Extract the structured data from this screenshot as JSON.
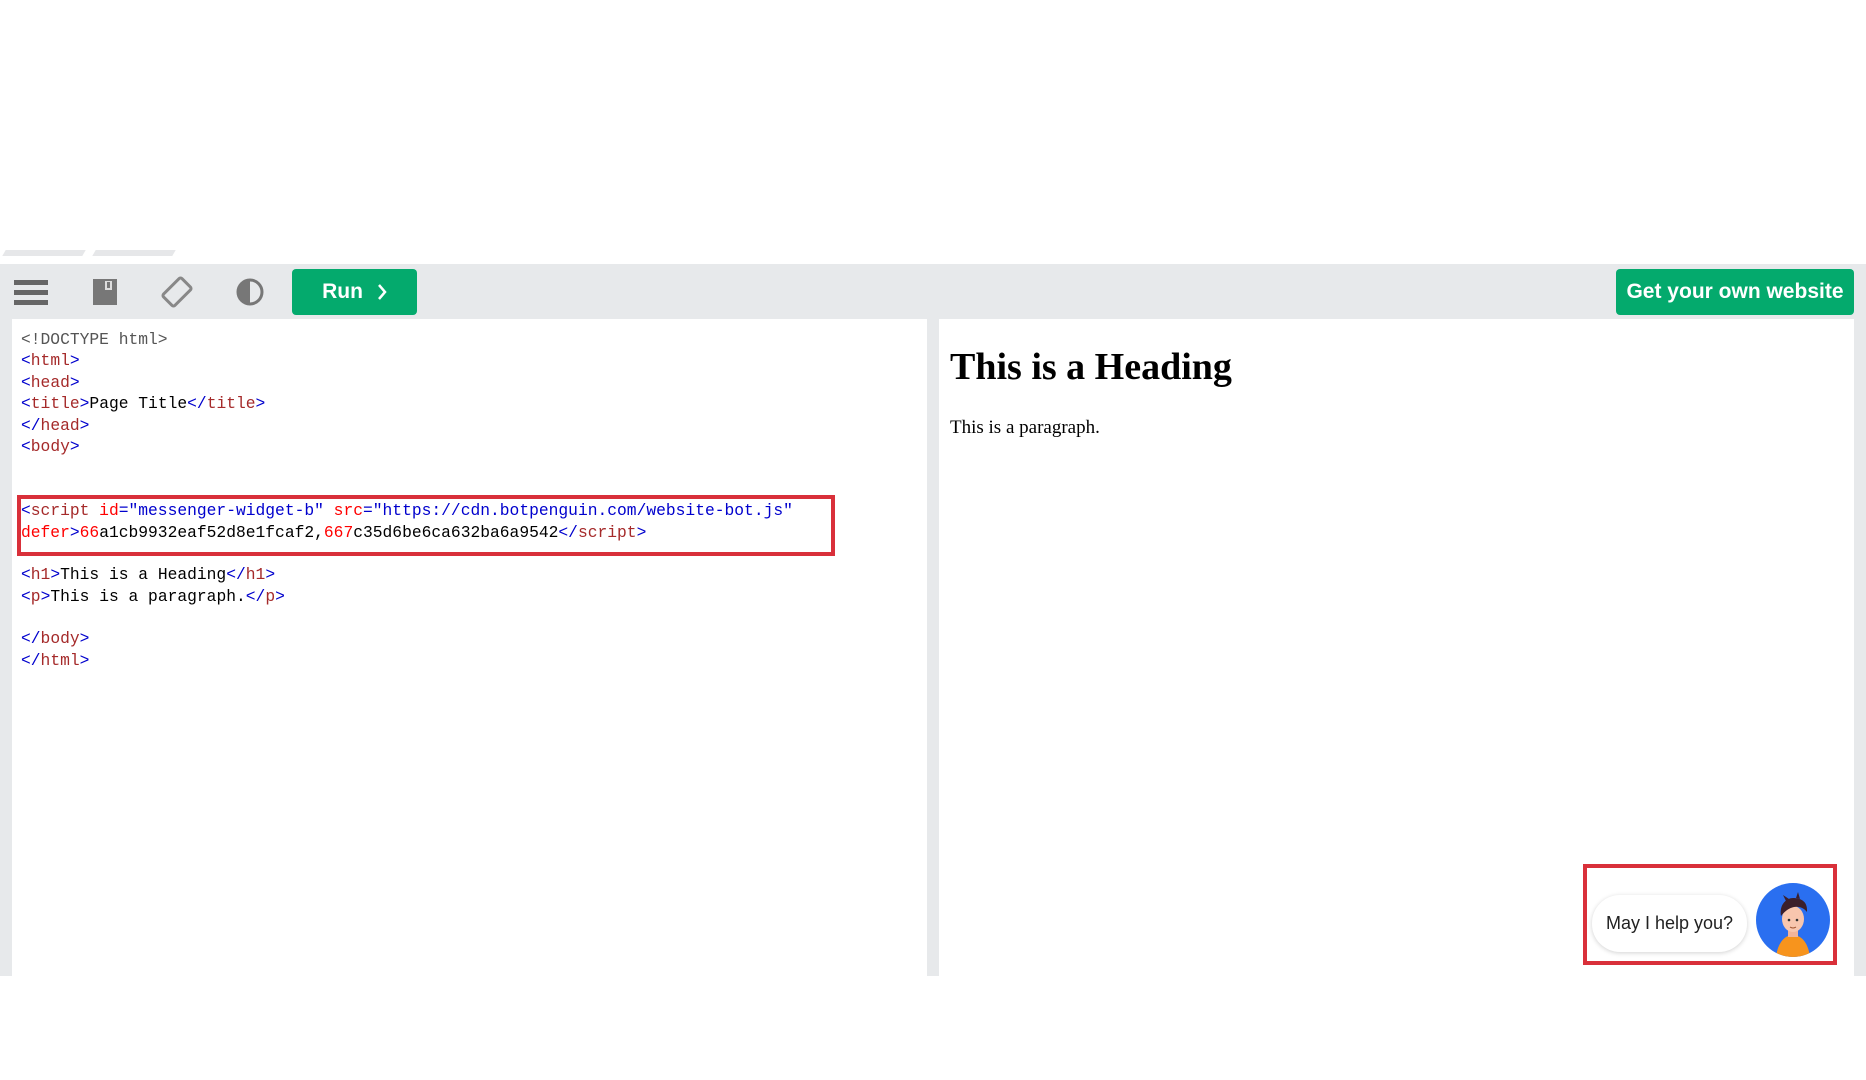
{
  "toolbar": {
    "icons": [
      "menu-icon",
      "save-icon",
      "rotate-icon",
      "contrast-icon"
    ],
    "run_label": "Run",
    "run_icon": "chevron-right-icon",
    "get_website_label": "Get your own website",
    "accent": "#04aa6d"
  },
  "editor": {
    "lines": [
      [
        {
          "t": "<!DOCTYPE html>",
          "c": "doc"
        }
      ],
      [
        {
          "t": "<",
          "c": "br"
        },
        {
          "t": "html",
          "c": "tag"
        },
        {
          "t": ">",
          "c": "br"
        }
      ],
      [
        {
          "t": "<",
          "c": "br"
        },
        {
          "t": "head",
          "c": "tag"
        },
        {
          "t": ">",
          "c": "br"
        }
      ],
      [
        {
          "t": "<",
          "c": "br"
        },
        {
          "t": "title",
          "c": "tag"
        },
        {
          "t": ">",
          "c": "br"
        },
        {
          "t": "Page Title",
          "c": "txt"
        },
        {
          "t": "</",
          "c": "br"
        },
        {
          "t": "title",
          "c": "tag"
        },
        {
          "t": ">",
          "c": "br"
        }
      ],
      [
        {
          "t": "</",
          "c": "br"
        },
        {
          "t": "head",
          "c": "tag"
        },
        {
          "t": ">",
          "c": "br"
        }
      ],
      [
        {
          "t": "<",
          "c": "br"
        },
        {
          "t": "body",
          "c": "tag"
        },
        {
          "t": ">",
          "c": "br"
        }
      ],
      [],
      [],
      [
        {
          "t": "<",
          "c": "br"
        },
        {
          "t": "script",
          "c": "tag"
        },
        {
          "t": " id",
          "c": "attr"
        },
        {
          "t": "=\"messenger-widget-b\"",
          "c": "val"
        },
        {
          "t": " src",
          "c": "attr"
        },
        {
          "t": "=\"https://cdn.botpenguin.com/website-bot.js\"",
          "c": "val"
        }
      ],
      [
        {
          "t": "defer",
          "c": "attr"
        },
        {
          "t": ">",
          "c": "br"
        },
        {
          "t": "66",
          "c": "attr"
        },
        {
          "t": "a1cb9932eaf52d8e1fcaf2,",
          "c": "txt"
        },
        {
          "t": "667",
          "c": "attr"
        },
        {
          "t": "c35d6be6ca632ba6a9542",
          "c": "txt"
        },
        {
          "t": "</",
          "c": "br"
        },
        {
          "t": "script",
          "c": "tag"
        },
        {
          "t": ">",
          "c": "br"
        }
      ],
      [],
      [
        {
          "t": "<",
          "c": "br"
        },
        {
          "t": "h1",
          "c": "tag"
        },
        {
          "t": ">",
          "c": "br"
        },
        {
          "t": "This is a Heading",
          "c": "txt"
        },
        {
          "t": "</",
          "c": "br"
        },
        {
          "t": "h1",
          "c": "tag"
        },
        {
          "t": ">",
          "c": "br"
        }
      ],
      [
        {
          "t": "<",
          "c": "br"
        },
        {
          "t": "p",
          "c": "tag"
        },
        {
          "t": ">",
          "c": "br"
        },
        {
          "t": "This is a paragraph.",
          "c": "txt"
        },
        {
          "t": "</",
          "c": "br"
        },
        {
          "t": "p",
          "c": "tag"
        },
        {
          "t": ">",
          "c": "br"
        }
      ],
      [],
      [
        {
          "t": "</",
          "c": "br"
        },
        {
          "t": "body",
          "c": "tag"
        },
        {
          "t": ">",
          "c": "br"
        }
      ],
      [
        {
          "t": "</",
          "c": "br"
        },
        {
          "t": "html",
          "c": "tag"
        },
        {
          "t": ">",
          "c": "br"
        }
      ]
    ]
  },
  "preview": {
    "heading": "This is a Heading",
    "paragraph": "This is a paragraph.",
    "chat_bubble": "May I help you?",
    "chat_avatar_color": "#2a6ff0"
  },
  "highlight_color": "#d9303a"
}
